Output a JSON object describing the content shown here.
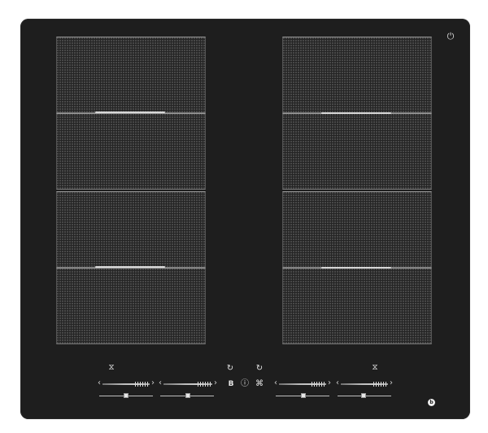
{
  "product": {
    "type": "induction-hob",
    "glass_color": "#1e1e1e",
    "zone_count": 8,
    "brand_text": "",
    "icons": [
      "flex-zone-icon",
      "timer-icon",
      "boost-icon",
      "info-icon",
      "lock-icon",
      "power-icon"
    ]
  },
  "controls": {
    "left_zone_symbol": "⧖",
    "right_zone_symbol": "⧖",
    "timer_left_symbol": "↻",
    "timer_right_symbol": "↻",
    "boost_label": "B",
    "info_symbol": "ⓘ",
    "lock_symbol": "⌘",
    "logo_symbol": "⏻",
    "arrow_left": "‹",
    "arrow_right": "›"
  },
  "colors": {
    "accent": "#d8d8d8",
    "dot_pattern": "#6a6a6a"
  }
}
